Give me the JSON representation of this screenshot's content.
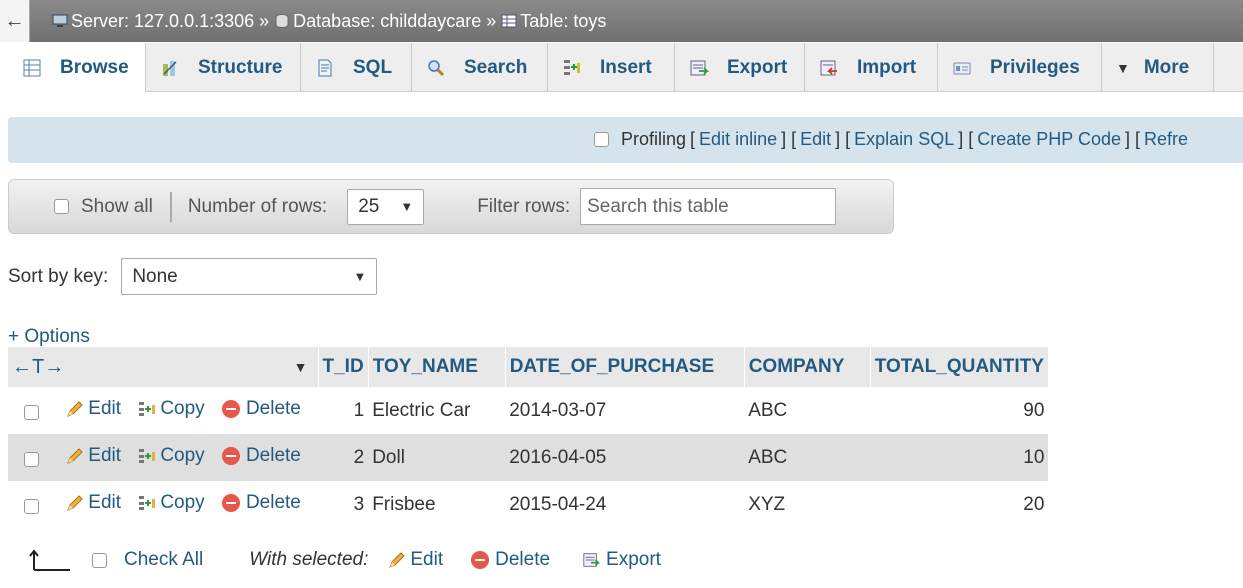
{
  "breadcrumb": {
    "server": "Server: 127.0.0.1:3306",
    "database": "Database: childdaycare",
    "table": "Table: toys",
    "separator": "»"
  },
  "tabs": [
    {
      "label": "Browse"
    },
    {
      "label": "Structure"
    },
    {
      "label": "SQL"
    },
    {
      "label": "Search"
    },
    {
      "label": "Insert"
    },
    {
      "label": "Export"
    },
    {
      "label": "Import"
    },
    {
      "label": "Privileges"
    },
    {
      "label": "More"
    }
  ],
  "profiling": {
    "label": "Profiling",
    "links": [
      "Edit inline",
      "Edit",
      "Explain SQL",
      "Create PHP Code",
      "Refre"
    ]
  },
  "nav": {
    "show_all": "Show all",
    "rows_label": "Number of rows:",
    "rows_value": "25",
    "filter_label": "Filter rows:",
    "filter_placeholder": "Search this table"
  },
  "sort": {
    "label": "Sort by key:",
    "value": "None"
  },
  "options_link": "+ Options",
  "table": {
    "columns": [
      "T_ID",
      "TOY_NAME",
      "DATE_OF_PURCHASE",
      "COMPANY",
      "TOTAL_QUANTITY"
    ],
    "actions": {
      "edit": "Edit",
      "copy": "Copy",
      "delete": "Delete"
    },
    "rows": [
      {
        "t_id": "1",
        "toy_name": "Electric Car",
        "date": "2014-03-07",
        "company": "ABC",
        "qty": "90"
      },
      {
        "t_id": "2",
        "toy_name": "Doll",
        "date": "2016-04-05",
        "company": "ABC",
        "qty": "10"
      },
      {
        "t_id": "3",
        "toy_name": "Frisbee",
        "date": "2015-04-24",
        "company": "XYZ",
        "qty": "20"
      }
    ]
  },
  "bottom": {
    "check_all": "Check All",
    "with_selected": "With selected:",
    "edit": "Edit",
    "delete": "Delete",
    "export": "Export"
  }
}
